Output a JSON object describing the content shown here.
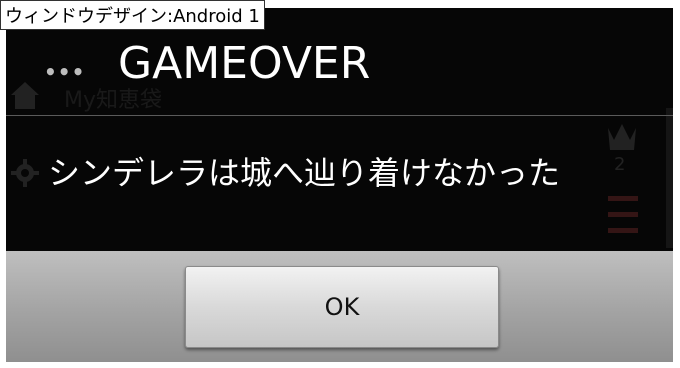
{
  "window": {
    "caption": "ウィンドウデザイン:Android 1"
  },
  "background_app": {
    "title": "My知恵袋",
    "right_digit": "2"
  },
  "dialog": {
    "menu_dots": "•••",
    "title": "GAMEOVER",
    "message": "シンデレラは城へ辿り着けなかった",
    "ok_label": "OK"
  },
  "colors": {
    "dialog_background": "#060606",
    "button_bar": "#a3a3a3",
    "button_face": "#d9d9d9",
    "text_primary": "#ffffff"
  },
  "icons": [
    "menu-dots-icon",
    "home-icon",
    "gear-icon",
    "crown-icon"
  ]
}
